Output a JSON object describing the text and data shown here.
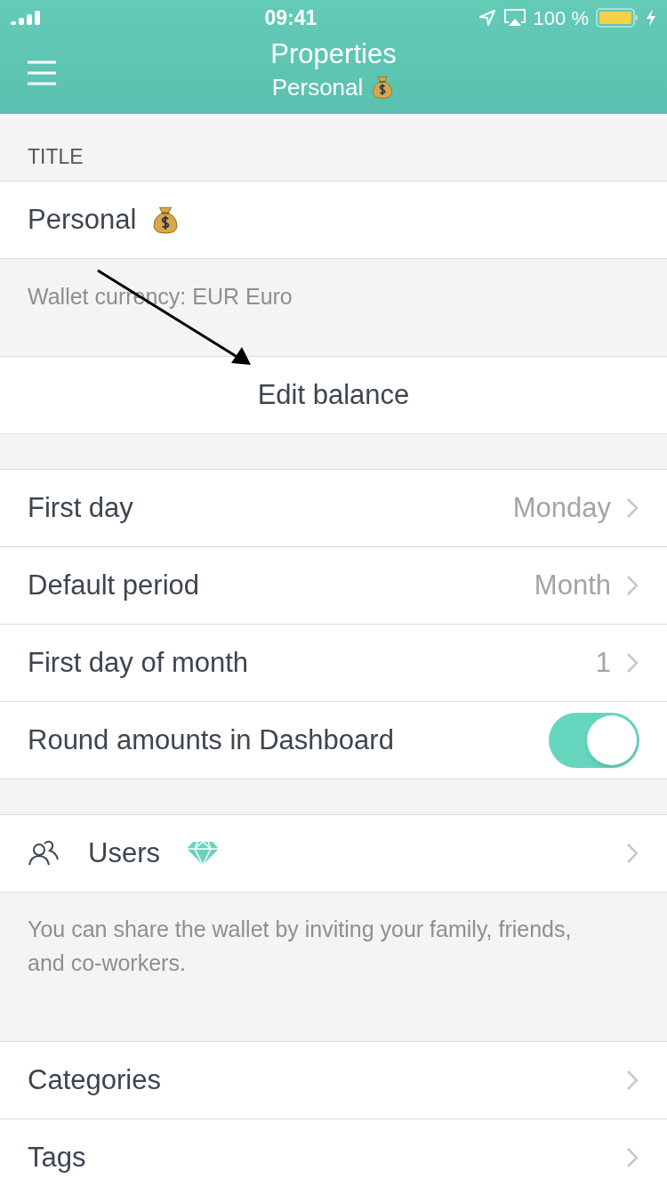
{
  "status_bar": {
    "time": "09:41",
    "battery": "100 %"
  },
  "nav": {
    "title": "Properties",
    "subtitle": "Personal"
  },
  "title_section": {
    "header": "TITLE",
    "value": "Personal",
    "footer": "Wallet currency: EUR Euro"
  },
  "edit_balance": "Edit balance",
  "settings": [
    {
      "kind": "value",
      "label": "First day",
      "value": "Monday"
    },
    {
      "kind": "value",
      "label": "Default period",
      "value": "Month"
    },
    {
      "kind": "value",
      "label": "First day of month",
      "value": "1"
    },
    {
      "kind": "toggle",
      "label": "Round amounts in Dashboard",
      "on": true
    }
  ],
  "users": {
    "label": "Users",
    "premium": true,
    "footer": "You can share the wallet by inviting your family, friends, and co-workers."
  },
  "links": [
    "Categories",
    "Tags"
  ]
}
